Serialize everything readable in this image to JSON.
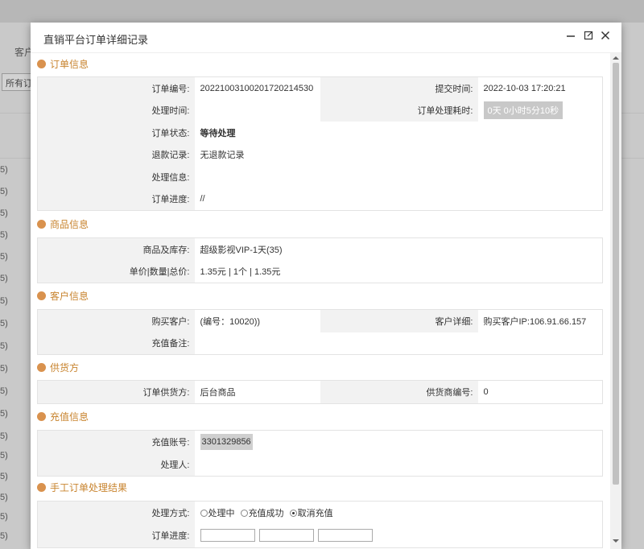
{
  "background": {
    "customer_label": "客户",
    "all_orders_select": "所有订",
    "row_suffix": "5)"
  },
  "dialog": {
    "title": "直销平台订单详细记录"
  },
  "order_info": {
    "section_title": "订单信息",
    "order_no_label": "订单编号:",
    "order_no": "20221003100201720214530",
    "submit_time_label": "提交时间:",
    "submit_time": "2022-10-03 17:20:21",
    "process_time_label": "处理时间:",
    "process_time": "",
    "duration_label": "订单处理耗时:",
    "duration": "0天 0小时5分10秒",
    "status_label": "订单状态:",
    "status": "等待处理",
    "refund_label": "退款记录:",
    "refund": "无退款记录",
    "process_info_label": "处理信息:",
    "process_info": "",
    "progress_label": "订单进度:",
    "progress": "//"
  },
  "goods_info": {
    "section_title": "商品信息",
    "goods_label": "商品及库存:",
    "goods": "超级影视VIP-1天(35)",
    "price_label": "单价|数量|总价:",
    "price": "1.35元 | 1个 | 1.35元"
  },
  "customer_info": {
    "section_title": "客户信息",
    "buyer_label": "购买客户:",
    "buyer": "(编号：10020))",
    "detail_label": "客户详细:",
    "detail": "购买客户IP:106.91.66.157",
    "remark_label": "充值备注:",
    "remark": ""
  },
  "supplier": {
    "section_title": "供货方",
    "supplier_label": "订单供货方:",
    "supplier": "后台商品",
    "supplier_no_label": "供货商编号:",
    "supplier_no": "0"
  },
  "recharge_info": {
    "section_title": "充值信息",
    "account_label": "充值账号:",
    "account": "3301329856",
    "handler_label": "处理人:",
    "handler": ""
  },
  "manual_result": {
    "section_title": "手工订单处理结果",
    "method_label": "处理方式:",
    "options": [
      "处理中",
      "充值成功",
      "取消充值"
    ],
    "selected_option": "取消充值",
    "progress_label": "订单进度:"
  }
}
